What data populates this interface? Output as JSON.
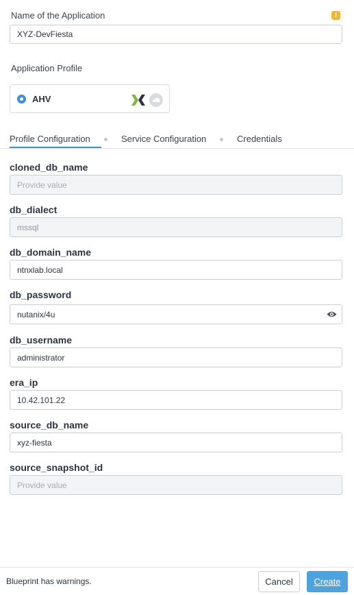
{
  "app": {
    "name_label": "Name of the Application",
    "name_value": "XYZ-DevFiesta",
    "warning_icon": "warning-icon"
  },
  "profile": {
    "label": "Application Profile",
    "option": "AHV",
    "icons": [
      "nutanix-logo-icon",
      "cloud-icon"
    ]
  },
  "tabs": [
    {
      "label": "Profile Configuration",
      "active": true
    },
    {
      "label": "Service Configuration",
      "active": false
    },
    {
      "label": "Credentials",
      "active": false
    }
  ],
  "variables": [
    {
      "name": "cloned_db_name",
      "value": "",
      "placeholder": "Provide value",
      "state": "disabled"
    },
    {
      "name": "db_dialect",
      "value": "mssql",
      "placeholder": "",
      "state": "readonly"
    },
    {
      "name": "db_domain_name",
      "value": "ntnxlab.local",
      "placeholder": "",
      "state": "editable"
    },
    {
      "name": "db_password",
      "value": "nutanix/4u",
      "placeholder": "",
      "state": "editable",
      "icon": "eye-icon"
    },
    {
      "name": "db_username",
      "value": "administrator",
      "placeholder": "",
      "state": "editable"
    },
    {
      "name": "era_ip",
      "value": "10.42.101.22",
      "placeholder": "",
      "state": "editable"
    },
    {
      "name": "source_db_name",
      "value": "xyz-fiesta",
      "placeholder": "",
      "state": "editable"
    },
    {
      "name": "source_snapshot_id",
      "value": "",
      "placeholder": "Provide value",
      "state": "disabled"
    }
  ],
  "footer": {
    "status": "Blueprint has warnings.",
    "cancel_label": "Cancel",
    "create_label": "Create"
  },
  "colors": {
    "accent": "#3d8fd6",
    "warning": "#f1b634",
    "create_button": "#4ea3dc"
  }
}
